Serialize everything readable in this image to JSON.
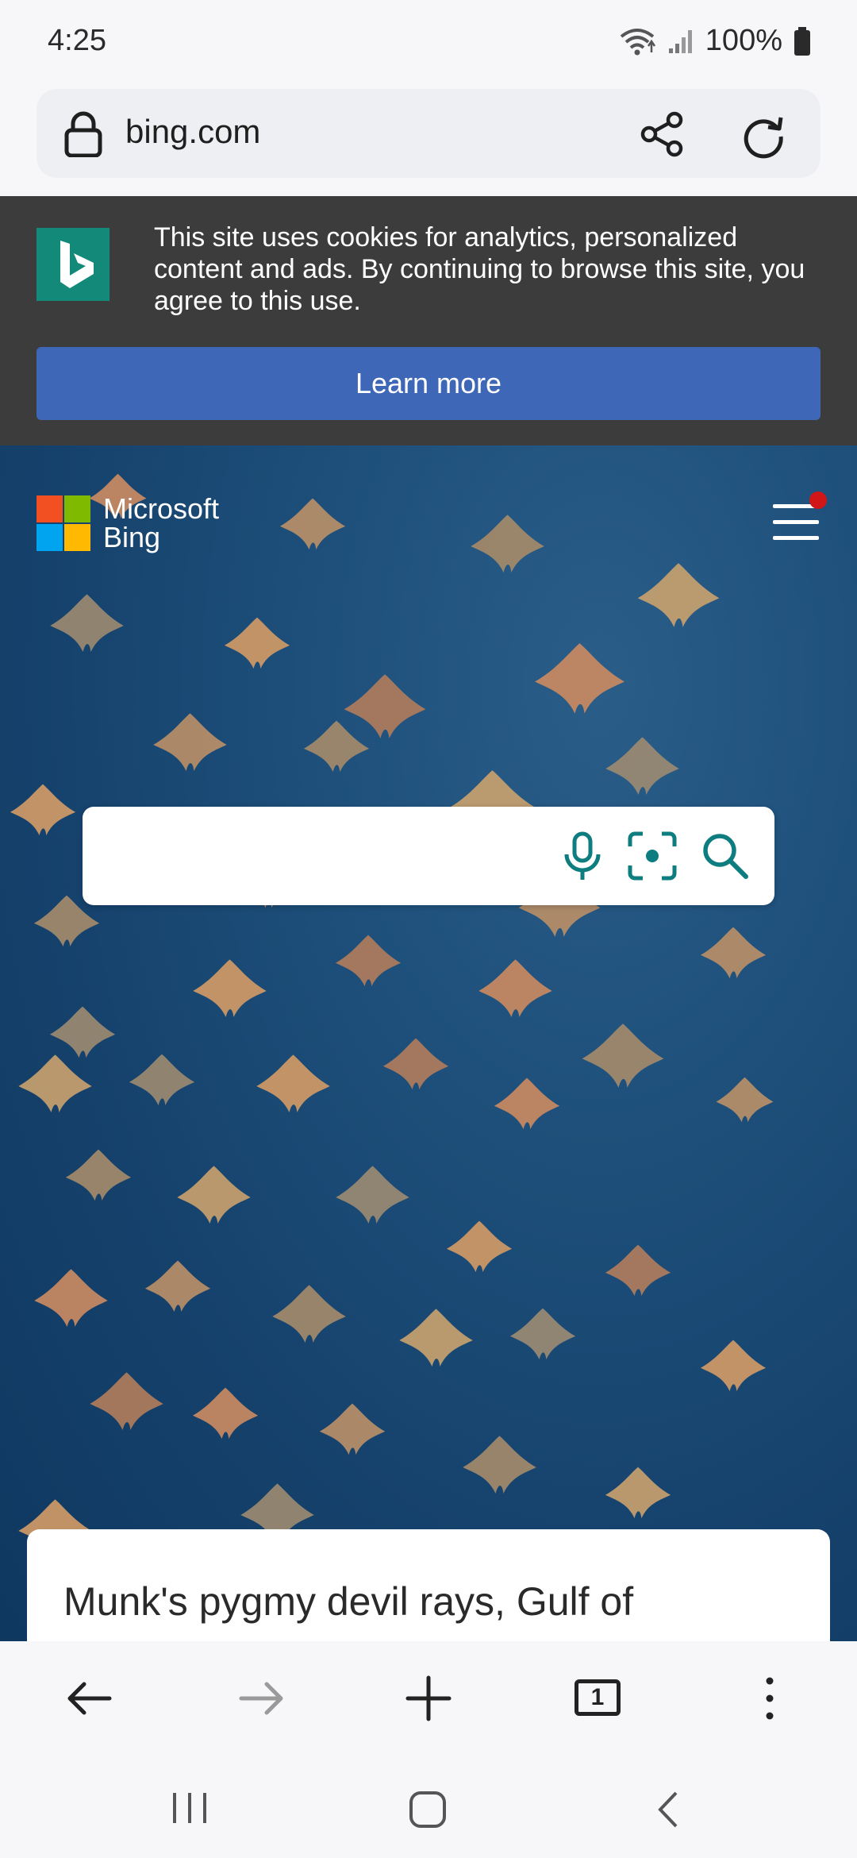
{
  "status_bar": {
    "time": "4:25",
    "battery": "100%"
  },
  "address_bar": {
    "url": "bing.com"
  },
  "cookie_banner": {
    "message": "This site uses cookies for analytics, personalized content and ads. By continuing to browse this site, you agree to this use.",
    "button_label": "Learn more"
  },
  "bing_header": {
    "brand_line1": "Microsoft",
    "brand_line2": "Bing",
    "logo_colors": [
      "#f25022",
      "#7fba00",
      "#00a4ef",
      "#ffb900"
    ],
    "notification_color": "#d01616"
  },
  "search": {
    "placeholder": "",
    "accent_color": "#0e7d7f"
  },
  "image_caption": {
    "title": "Munk's pygmy devil rays, Gulf of"
  },
  "toolbar": {
    "tab_count": "1"
  }
}
